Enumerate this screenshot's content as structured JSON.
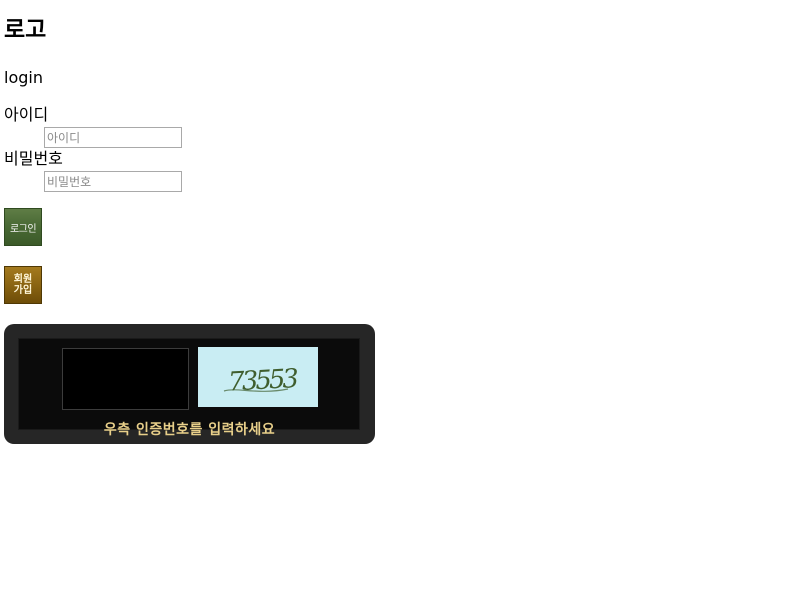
{
  "page": {
    "title": "로고",
    "subtitle": "login"
  },
  "form": {
    "id_label": "아이디",
    "id_placeholder": "아이디",
    "id_value": "",
    "pw_label": "비밀번호",
    "pw_placeholder": "비밀번호",
    "pw_value": ""
  },
  "buttons": {
    "login_label": "로그인",
    "join_label_line1": "회원",
    "join_label_line2": "가입",
    "login_color": "#4a6a35",
    "join_color": "#8a6412"
  },
  "captcha": {
    "code_text": "73553",
    "hint": "우측 인증번호를 입력하세요",
    "input_value": "",
    "background_color": "#262626",
    "image_background": "#c9edf3",
    "hint_color": "#e8cf8a"
  }
}
